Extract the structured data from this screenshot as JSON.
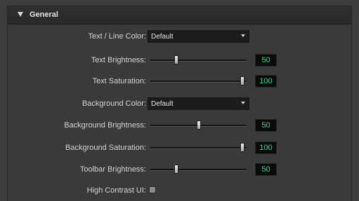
{
  "section": {
    "title": "General"
  },
  "colors": {
    "value_text": "#25e28c",
    "value_bg": "#0a0a0a",
    "panel_bg": "#3a3a3a",
    "header_bg": "#2c2c2c"
  },
  "settings": {
    "text_line_color": {
      "label": "Text / Line Color:",
      "value": "Default"
    },
    "text_brightness": {
      "label": "Text Brightness:",
      "value": "50",
      "level": 0.25
    },
    "text_saturation": {
      "label": "Text Saturation:",
      "value": "100",
      "level": 1.0
    },
    "background_color": {
      "label": "Background Color:",
      "value": "Default"
    },
    "background_brightness": {
      "label": "Background Brightness:",
      "value": "50",
      "level": 0.5
    },
    "background_saturation": {
      "label": "Background Saturation:",
      "value": "100",
      "level": 1.0
    },
    "toolbar_brightness": {
      "label": "Toolbar Brightness:",
      "value": "50",
      "level": 0.25
    },
    "high_contrast_ui": {
      "label": "High Contrast UI:",
      "checked": false
    }
  }
}
